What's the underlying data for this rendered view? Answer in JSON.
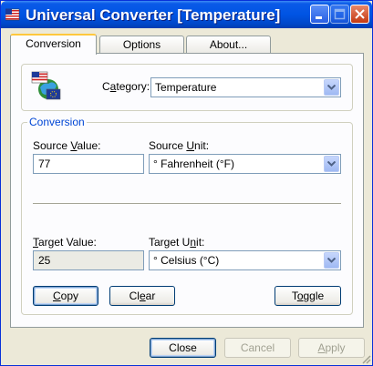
{
  "window": {
    "title": "Universal Converter [Temperature]"
  },
  "tabs": [
    {
      "label": "Conversion",
      "active": true
    },
    {
      "label": "Options",
      "active": false
    },
    {
      "label": "About...",
      "active": false
    }
  ],
  "category": {
    "label_pre": "C",
    "label_accel": "a",
    "label_post": "tegory:",
    "value": "Temperature"
  },
  "conversion_group": {
    "legend": "Conversion",
    "source_value_label_pre": "Source ",
    "source_value_label_accel": "V",
    "source_value_label_post": "alue:",
    "source_value": "77",
    "source_unit_label_pre": "Source ",
    "source_unit_label_accel": "U",
    "source_unit_label_post": "nit:",
    "source_unit": "° Fahrenheit (°F)",
    "target_value_label_pre": "",
    "target_value_label_accel": "T",
    "target_value_label_post": "arget Value:",
    "target_value": "25",
    "target_unit_label_pre": "Target U",
    "target_unit_label_accel": "n",
    "target_unit_label_post": "it:",
    "target_unit": "° Celsius (°C)"
  },
  "actions": {
    "copy_accel": "C",
    "copy_rest": "opy",
    "clear_pre": "Cl",
    "clear_accel": "e",
    "clear_post": "ar",
    "toggle_pre": "T",
    "toggle_accel": "o",
    "toggle_post": "ggle"
  },
  "dialog_buttons": {
    "close": "Close",
    "cancel": "Cancel",
    "apply_accel": "A",
    "apply_rest": "pply"
  },
  "colors": {
    "titlebar": "#0054e3",
    "legend": "#0046d5",
    "tab_highlight": "#ffc83c"
  }
}
